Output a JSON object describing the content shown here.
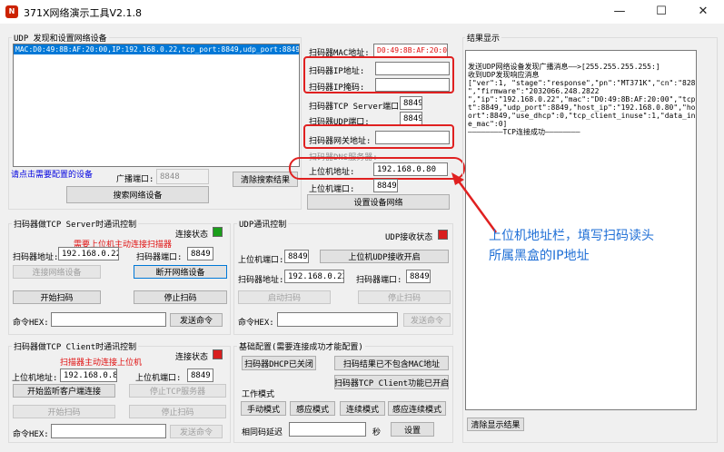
{
  "window": {
    "title": "371X网络演示工具V2.1.8",
    "controls": {
      "minimize": "—",
      "maximize": "☐",
      "close": "✕"
    }
  },
  "udp_group": {
    "title": "UDP 发现和设置网络设备",
    "list_item": "MAC:D0:49:8B:AF:20:00,IP:192.168.0.22,tcp_port:8849,udp_port:8849,host_port",
    "hint": "请点击需要配置的设备",
    "broadcast_port_label": "广播端口:",
    "broadcast_port_value": "8848",
    "clear_button": "清除搜索结果",
    "search_button": "搜索网络设备"
  },
  "device_config": {
    "mac_label": "扫码器MAC地址:",
    "mac_value": "D0:49:8B:AF:20:00",
    "ip_label": "扫码器IP地址:",
    "ip_value": "",
    "mask_label": "扫码器IP掩码:",
    "mask_value": "",
    "tcp_port_label": "扫码器TCP Server端口:",
    "tcp_port_value": "8849",
    "udp_port_label": "扫码器UDP端口:",
    "udp_port_value": "8849",
    "gateway_label": "扫码器网关地址:",
    "gateway_value": "",
    "dns_label": "扫码器DNS服务器:",
    "host_addr_label": "上位机地址:",
    "host_addr_value": "192.168.0.80",
    "host_port_label": "上位机端口:",
    "host_port_value": "8849",
    "set_button": "设置设备网络"
  },
  "tcp_server_group": {
    "title": "扫码器做TCP Server时通讯控制",
    "status_label": "连接状态",
    "status_color": "#1a9e1a",
    "hint": "需要上位机主动连接扫描器",
    "addr_label": "扫码器地址:",
    "addr_value": "192.168.0.22",
    "port_label": "扫码器端口:",
    "port_value": "8849",
    "connect_button": "连接网络设备",
    "disconnect_button": "断开网络设备",
    "start_button": "开始扫码",
    "stop_button": "停止扫码",
    "cmd_label": "命令HEX:",
    "cmd_value": "",
    "send_button": "发送命令"
  },
  "udp_comm_group": {
    "title": "UDP通讯控制",
    "status_label": "UDP接收状态",
    "status_color": "#d81e1e",
    "host_port_label": "上位机端口:",
    "host_port_value": "8849",
    "open_button": "上位机UDP接收开启",
    "addr_label": "扫码器地址:",
    "addr_value": "192.168.0.22",
    "port_label": "扫码器端口:",
    "port_value": "8849",
    "start_button": "启动扫码",
    "stop_button": "停止扫码",
    "cmd_label": "命令HEX:",
    "cmd_value": "",
    "send_button": "发送命令"
  },
  "tcp_client_group": {
    "title": "扫码器做TCP Client时通讯控制",
    "status_label": "连接状态",
    "status_color": "#d81e1e",
    "hint": "扫描器主动连接上位机",
    "host_addr_label": "上位机地址:",
    "host_addr_value": "192.168.0.80",
    "host_port_label": "上位机端口:",
    "host_port_value": "8849",
    "listen_button": "开始监听客户端连接",
    "stop_server_button": "停止TCP服务器",
    "start_button": "开始扫码",
    "stop_button": "停止扫码",
    "cmd_label": "命令HEX:",
    "cmd_value": "",
    "send_button": "发送命令"
  },
  "basic_config": {
    "title": "基础配置(需要连接成功才能配置)",
    "dhcp_button": "扫码器DHCP已关闭",
    "mac_button": "扫码结果已不包含MAC地址",
    "client_button": "扫码器TCP Client功能已开启",
    "work_mode_label": "工作模式",
    "mode_manual": "手动模式",
    "mode_sense": "感应模式",
    "mode_continuous": "连续模式",
    "mode_sense_continuous": "感应连续模式",
    "delay_label": "相同码延迟",
    "delay_value": "",
    "delay_unit": "秒",
    "set_button": "设置"
  },
  "results": {
    "title": "结果显示",
    "lines": [
      "",
      "发送UDP网络设备发现广播消息——>[255.255.255.255:]",
      "收到UDP发现响应消息",
      "[\"ver\":1, \"stage\":\"response\",\"pn\":\"MT371K\",\"cn\":\"828",
      "\",\"firmware\":\"2032066.248.2822",
      "\",\"ip\":\"192.168.0.22\",\"mac\":\"D0:49:8B:AF:20:00\",\"tcp_por",
      "t\":8849,\"udp_port\":8849,\"host_ip\":\"192.168.0.80\",\"host_p",
      "ort\":8849,\"use_dhcp\":0,\"tcp_client_inuse\":1,\"data_includ",
      "e_mac\":0]",
      "————————TCP连接成功————————"
    ],
    "clear_button": "清除显示结果"
  },
  "annotation": {
    "line1": "上位机地址栏，填写扫码读头",
    "line2": "所属黑盒的IP地址",
    "color": "#1f6fd6"
  }
}
